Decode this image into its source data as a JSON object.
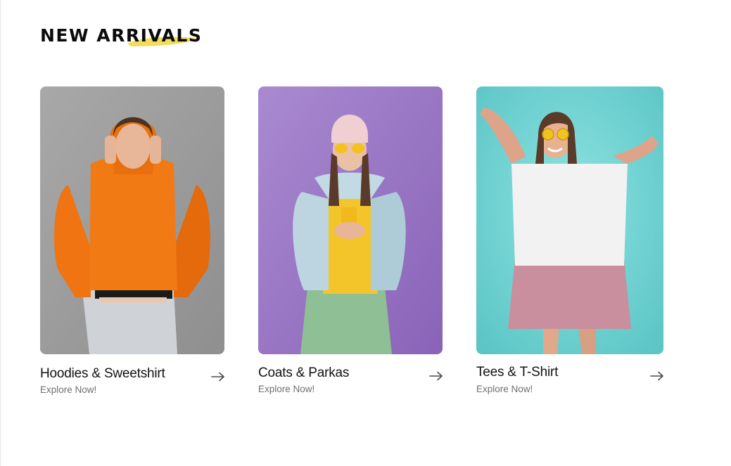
{
  "section": {
    "title": "NEW ARRIVALS",
    "highlight_color": "#f1dc5c"
  },
  "cards": [
    {
      "title": "Hoodies & Sweetshirt",
      "link": "Explore Now!",
      "icon": "arrow-right-icon",
      "background_color": "#9e9e9e",
      "garment_color": "#f0720f"
    },
    {
      "title": "Coats & Parkas",
      "link": "Explore Now!",
      "icon": "arrow-right-icon",
      "background_color": "#a27fc6",
      "garment_color": "#b9d3de"
    },
    {
      "title": "Tees & T-Shirt",
      "link": "Explore Now!",
      "icon": "arrow-right-icon",
      "background_color": "#7fd3d2",
      "garment_color": "#f1f1f1"
    }
  ]
}
